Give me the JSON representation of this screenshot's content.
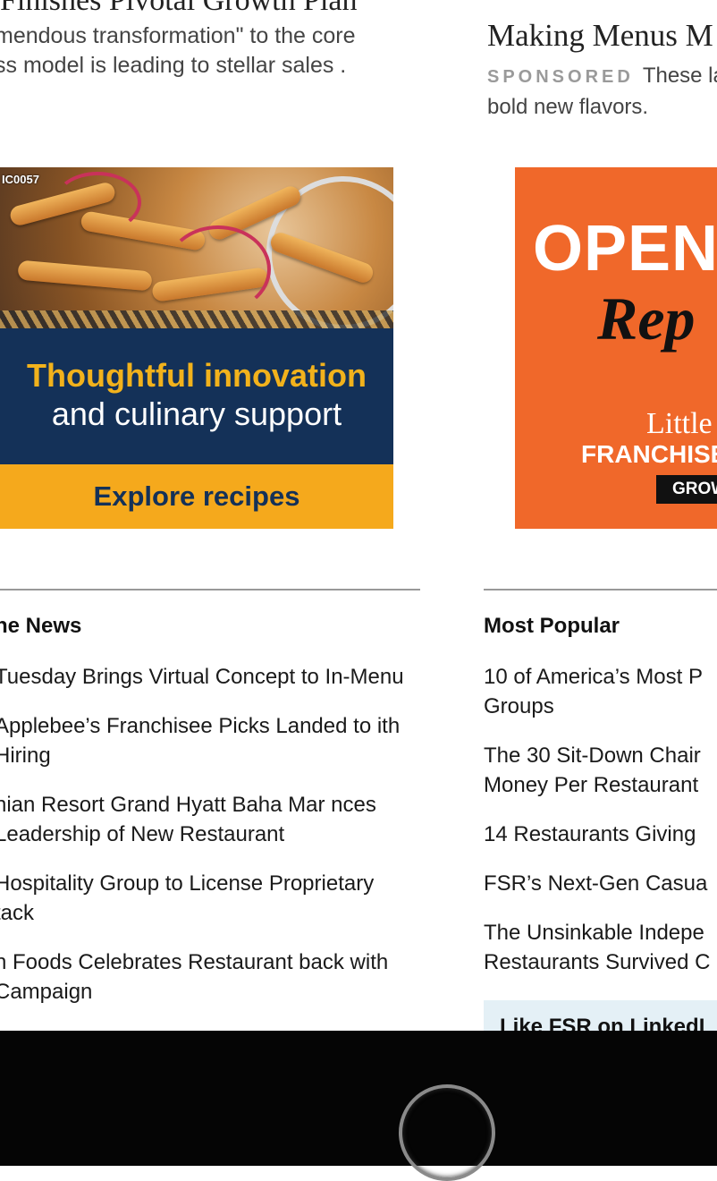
{
  "left_story": {
    "title_clip": "Finishes Pivotal Growth Plan",
    "description": "mendous transformation\" to the core ss model is leading to stellar sales ."
  },
  "right_story": {
    "title": "Making Menus M",
    "sponsored_label": "SPONSORED",
    "description": "These la bold new flavors."
  },
  "ad_left": {
    "code": "IC0057",
    "headline": "Thoughtful innovation",
    "subhead": "and culinary support",
    "cta": "Explore recipes",
    "colors": {
      "navy": "#143158",
      "gold": "#f2b21c",
      "orange": "#f5a91c"
    }
  },
  "ad_right": {
    "open_text": "OPEN.",
    "script_text": "Rep",
    "little_text": "Little",
    "franchise_text": "FRANCHISE",
    "grow_text": "GROW",
    "background": "#f0682a"
  },
  "online_news": {
    "heading": "ne News",
    "items": [
      "Tuesday Brings Virtual Concept to In-Menu",
      "Applebee’s Franchisee Picks Landed to ith Hiring",
      "nian Resort Grand Hyatt Baha Mar nces Leadership of New Restaurant",
      "Hospitality Group to License Proprietary tack",
      "n Foods Celebrates Restaurant back with Campaign"
    ]
  },
  "most_popular": {
    "heading": "Most Popular",
    "items": [
      "10 of America’s Most P Groups",
      "The 30 Sit-Down Chair Money Per Restaurant",
      "14 Restaurants Giving",
      "FSR’s Next-Gen Casua",
      "The Unsinkable Indepe Restaurants Survived C"
    ]
  },
  "linkedin": {
    "label": "Like FSR on LinkedI"
  },
  "device": {
    "home_button_icon": "home-button-icon"
  }
}
